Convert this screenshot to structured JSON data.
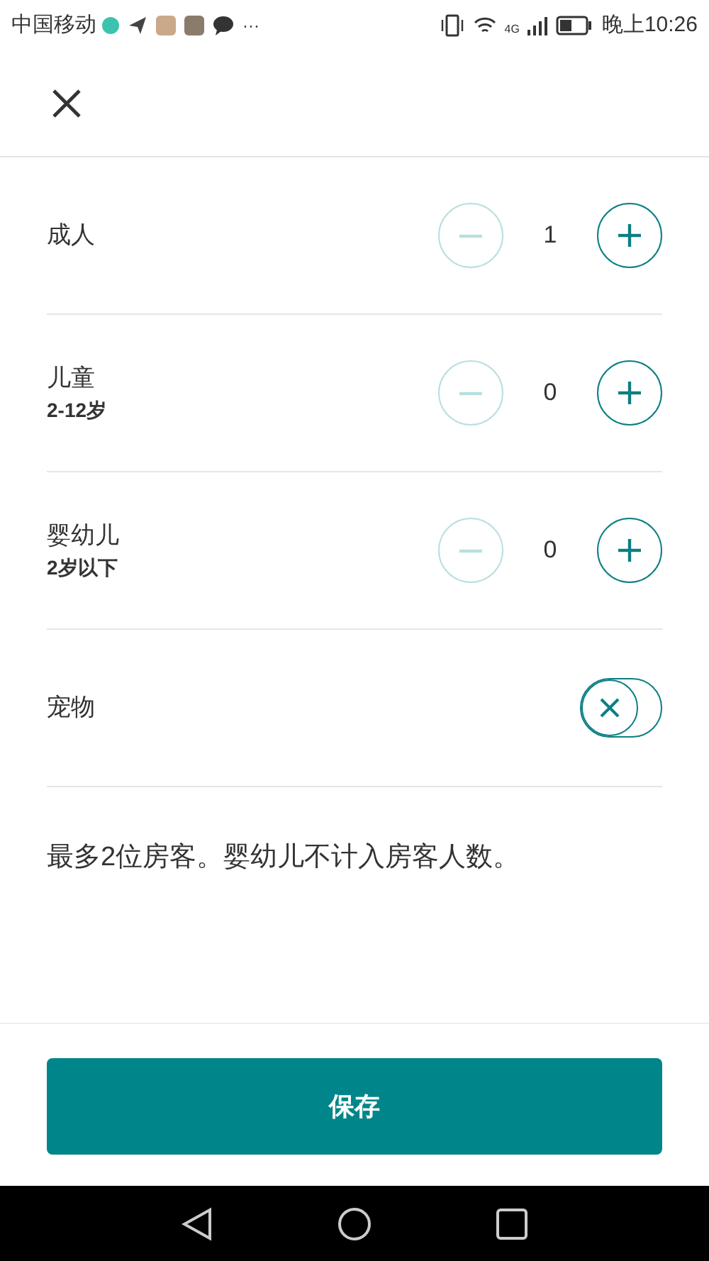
{
  "status_bar": {
    "carrier": "中国移动",
    "more": "···",
    "time": "晚上10:26",
    "network": "4G"
  },
  "rows": [
    {
      "kind": "counter",
      "label": "成人",
      "value": "1",
      "minus_disabled": true,
      "plus_disabled": false
    },
    {
      "kind": "counter",
      "label": "儿童",
      "sublabel": "2-12岁",
      "value": "0",
      "minus_disabled": true,
      "plus_disabled": false
    },
    {
      "kind": "counter",
      "label": "婴幼儿",
      "sublabel": "2岁以下",
      "value": "0",
      "minus_disabled": true,
      "plus_disabled": false
    },
    {
      "kind": "toggle",
      "label": "宠物",
      "on": false
    }
  ],
  "note": "最多2位房客。婴幼儿不计入房客人数。",
  "save_button": "保存"
}
